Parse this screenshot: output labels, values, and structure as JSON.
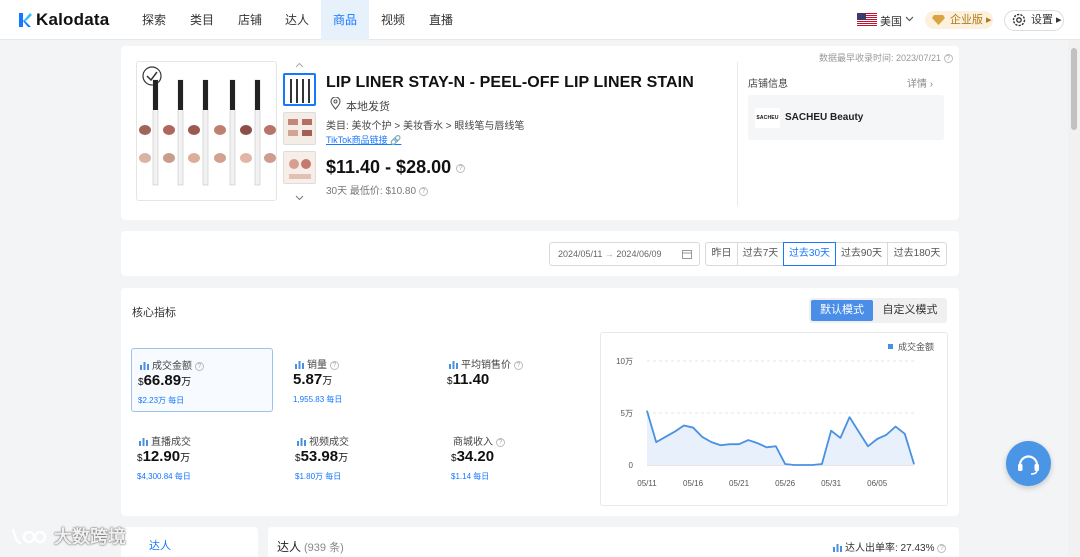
{
  "nav": {
    "brand": "Kalodata",
    "items": [
      {
        "label": "探索",
        "active": false
      },
      {
        "label": "类目",
        "active": false
      },
      {
        "label": "店铺",
        "active": false
      },
      {
        "label": "达人",
        "active": false
      },
      {
        "label": "商品",
        "active": true
      },
      {
        "label": "视频",
        "active": false
      },
      {
        "label": "直播",
        "active": false
      }
    ],
    "region": "美国",
    "enterprise": "企业版",
    "settings": "设置"
  },
  "product": {
    "collected_at": "数据最早收录时间: 2023/07/21",
    "title": "LIP LINER STAY-N - PEEL-OFF LIP LINER STAIN",
    "shipping": "本地发货",
    "category": "类目: 美妆个护 > 美妆香水 > 眼线笔与唇线笔",
    "tiktok_link": "TikTok商品链接",
    "price_range": "$11.40 - $28.00",
    "lowest_30d": "30天 最低价: $10.80"
  },
  "shop": {
    "section_label": "店铺信息",
    "more_label": "详情",
    "logo_text": "SACHEU",
    "name": "SACHEU Beauty"
  },
  "date_filter": {
    "start": "2024/05/11",
    "arrow": "→",
    "end": "2024/06/09",
    "ranges": [
      {
        "label": "昨日",
        "active": false
      },
      {
        "label": "过去7天",
        "active": false
      },
      {
        "label": "过去30天",
        "active": true
      },
      {
        "label": "过去90天",
        "active": false
      },
      {
        "label": "过去180天",
        "active": false
      }
    ]
  },
  "core": {
    "title": "核心指标",
    "modes": [
      {
        "label": "默认模式",
        "active": true
      },
      {
        "label": "自定义模式",
        "active": false
      }
    ],
    "metrics": [
      {
        "label": "成交金额",
        "currency": "$",
        "value": "66.89",
        "unit": "万",
        "sub": "$2.23万 每日",
        "selected": true
      },
      {
        "label": "销量",
        "currency": "",
        "value": "5.87",
        "unit": "万",
        "sub": "1,955.83 每日",
        "selected": false
      },
      {
        "label": "平均销售价",
        "currency": "$",
        "value": "11.40",
        "unit": "",
        "sub": "",
        "selected": false
      },
      {
        "label": "直播成交",
        "currency": "$",
        "value": "12.90",
        "unit": "万",
        "sub": "$4,300.84 每日",
        "selected": false
      },
      {
        "label": "视频成交",
        "currency": "$",
        "value": "53.98",
        "unit": "万",
        "sub": "$1.80万 每日",
        "selected": false
      },
      {
        "label": "商城收入",
        "currency": "$",
        "value": "34.20",
        "unit": "",
        "sub": "$1.14 每日",
        "selected": false
      }
    ]
  },
  "chart_data": {
    "type": "area",
    "legend": "成交金额",
    "legend_position": "top-right",
    "y_ticks": [
      "10万",
      "5万",
      "0"
    ],
    "ylim": [
      0,
      100000
    ],
    "x_ticks": [
      "05/11",
      "05/16",
      "05/21",
      "05/26",
      "05/31",
      "06/05"
    ],
    "x": [
      "05/11",
      "05/12",
      "05/13",
      "05/14",
      "05/15",
      "05/16",
      "05/17",
      "05/18",
      "05/19",
      "05/20",
      "05/21",
      "05/22",
      "05/23",
      "05/24",
      "05/25",
      "05/26",
      "05/27",
      "05/28",
      "05/29",
      "05/30",
      "05/31",
      "06/01",
      "06/02",
      "06/03",
      "06/04",
      "06/05",
      "06/06",
      "06/07",
      "06/08",
      "06/09"
    ],
    "values": [
      52000,
      22000,
      27000,
      32000,
      38000,
      36000,
      27000,
      22000,
      19000,
      20000,
      20000,
      24000,
      21000,
      17000,
      18000,
      1000,
      0,
      0,
      0,
      1000,
      33000,
      26000,
      46000,
      32000,
      18000,
      25000,
      29000,
      37000,
      30000,
      1000
    ],
    "line_color": "#4a90e2",
    "area_color": "#e8f1fb"
  },
  "bottom": {
    "left_tab": "达人",
    "main_title": "达人",
    "count": "(939 条)",
    "rate": "达人出单率: 27.43%"
  },
  "watermark": "大数跨境"
}
